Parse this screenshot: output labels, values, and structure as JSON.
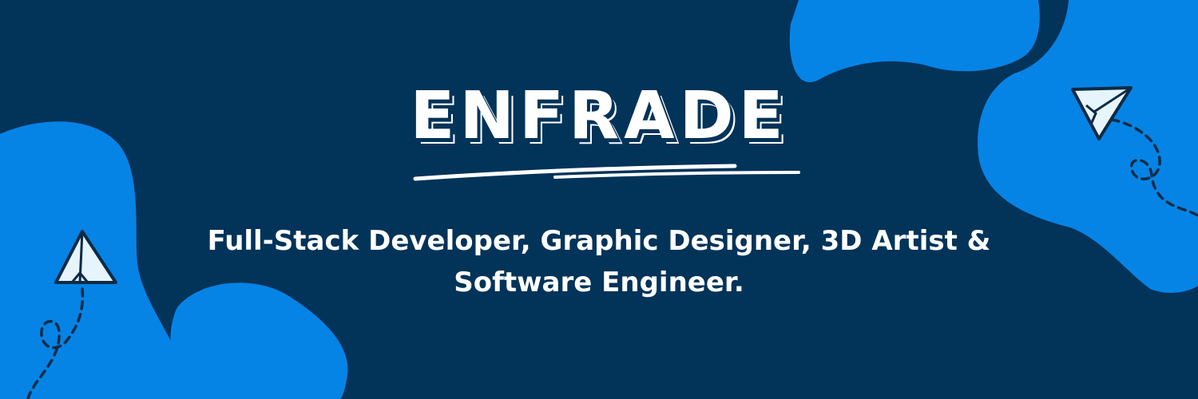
{
  "banner": {
    "brand_name": "ENFRADE",
    "tagline": "Full-Stack Developer, Graphic Designer, 3D Artist & Software Engineer."
  },
  "colors": {
    "background": "#023359",
    "blob": "#0584e6",
    "text": "#ffffff",
    "plane_fill": "#e6f4fb"
  },
  "icons": [
    "paper-plane-icon",
    "paper-plane-icon"
  ]
}
